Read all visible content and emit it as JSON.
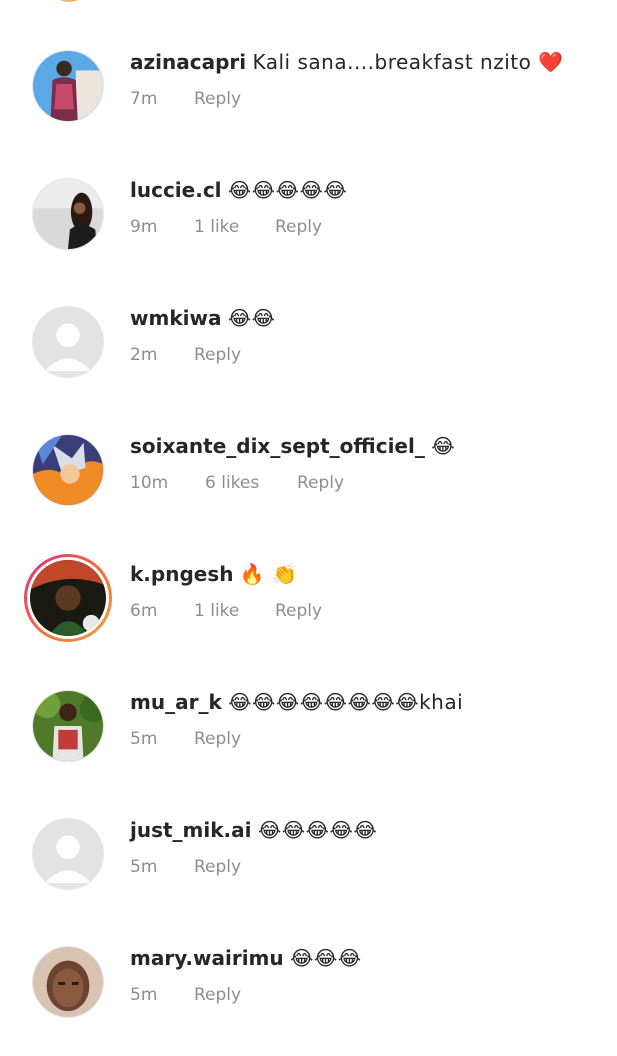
{
  "comments": [
    {
      "username": "azinacapri",
      "text": "Kali sana....breakfast nzito ❤️",
      "time": "7m",
      "likes": "",
      "reply": "Reply",
      "avatar": "photo-blue-sky"
    },
    {
      "username": "luccie.cl",
      "text": "😂😂😂😂😂",
      "time": "9m",
      "likes": "1 like",
      "reply": "Reply",
      "avatar": "photo-grey"
    },
    {
      "username": "wmkiwa",
      "text": "😂😂",
      "time": "2m",
      "likes": "",
      "reply": "Reply",
      "avatar": "default-person"
    },
    {
      "username": "soixante_dix_sept_officiel_",
      "text": "😂",
      "time": "10m",
      "likes": "6 likes",
      "reply": "Reply",
      "avatar": "photo-anime"
    },
    {
      "username": "k.pngesh",
      "text": "🔥 👏",
      "time": "6m",
      "likes": "1 like",
      "reply": "Reply",
      "avatar": "photo-dark-story"
    },
    {
      "username": "mu_ar_k",
      "text": "😂😂😂😂😂😂😂😂khai",
      "time": "5m",
      "likes": "",
      "reply": "Reply",
      "avatar": "photo-green"
    },
    {
      "username": "just_mik.ai",
      "text": "😂😂😂😂😂",
      "time": "5m",
      "likes": "",
      "reply": "Reply",
      "avatar": "default-person"
    },
    {
      "username": "mary.wairimu",
      "text": "😂😂😂",
      "time": "5m",
      "likes": "",
      "reply": "Reply",
      "avatar": "photo-portrait"
    }
  ],
  "colors": {
    "username": "#262626",
    "meta": "#8e8e8e",
    "story_ring_start": "#d52f8c",
    "story_ring_end": "#f9a03f"
  }
}
